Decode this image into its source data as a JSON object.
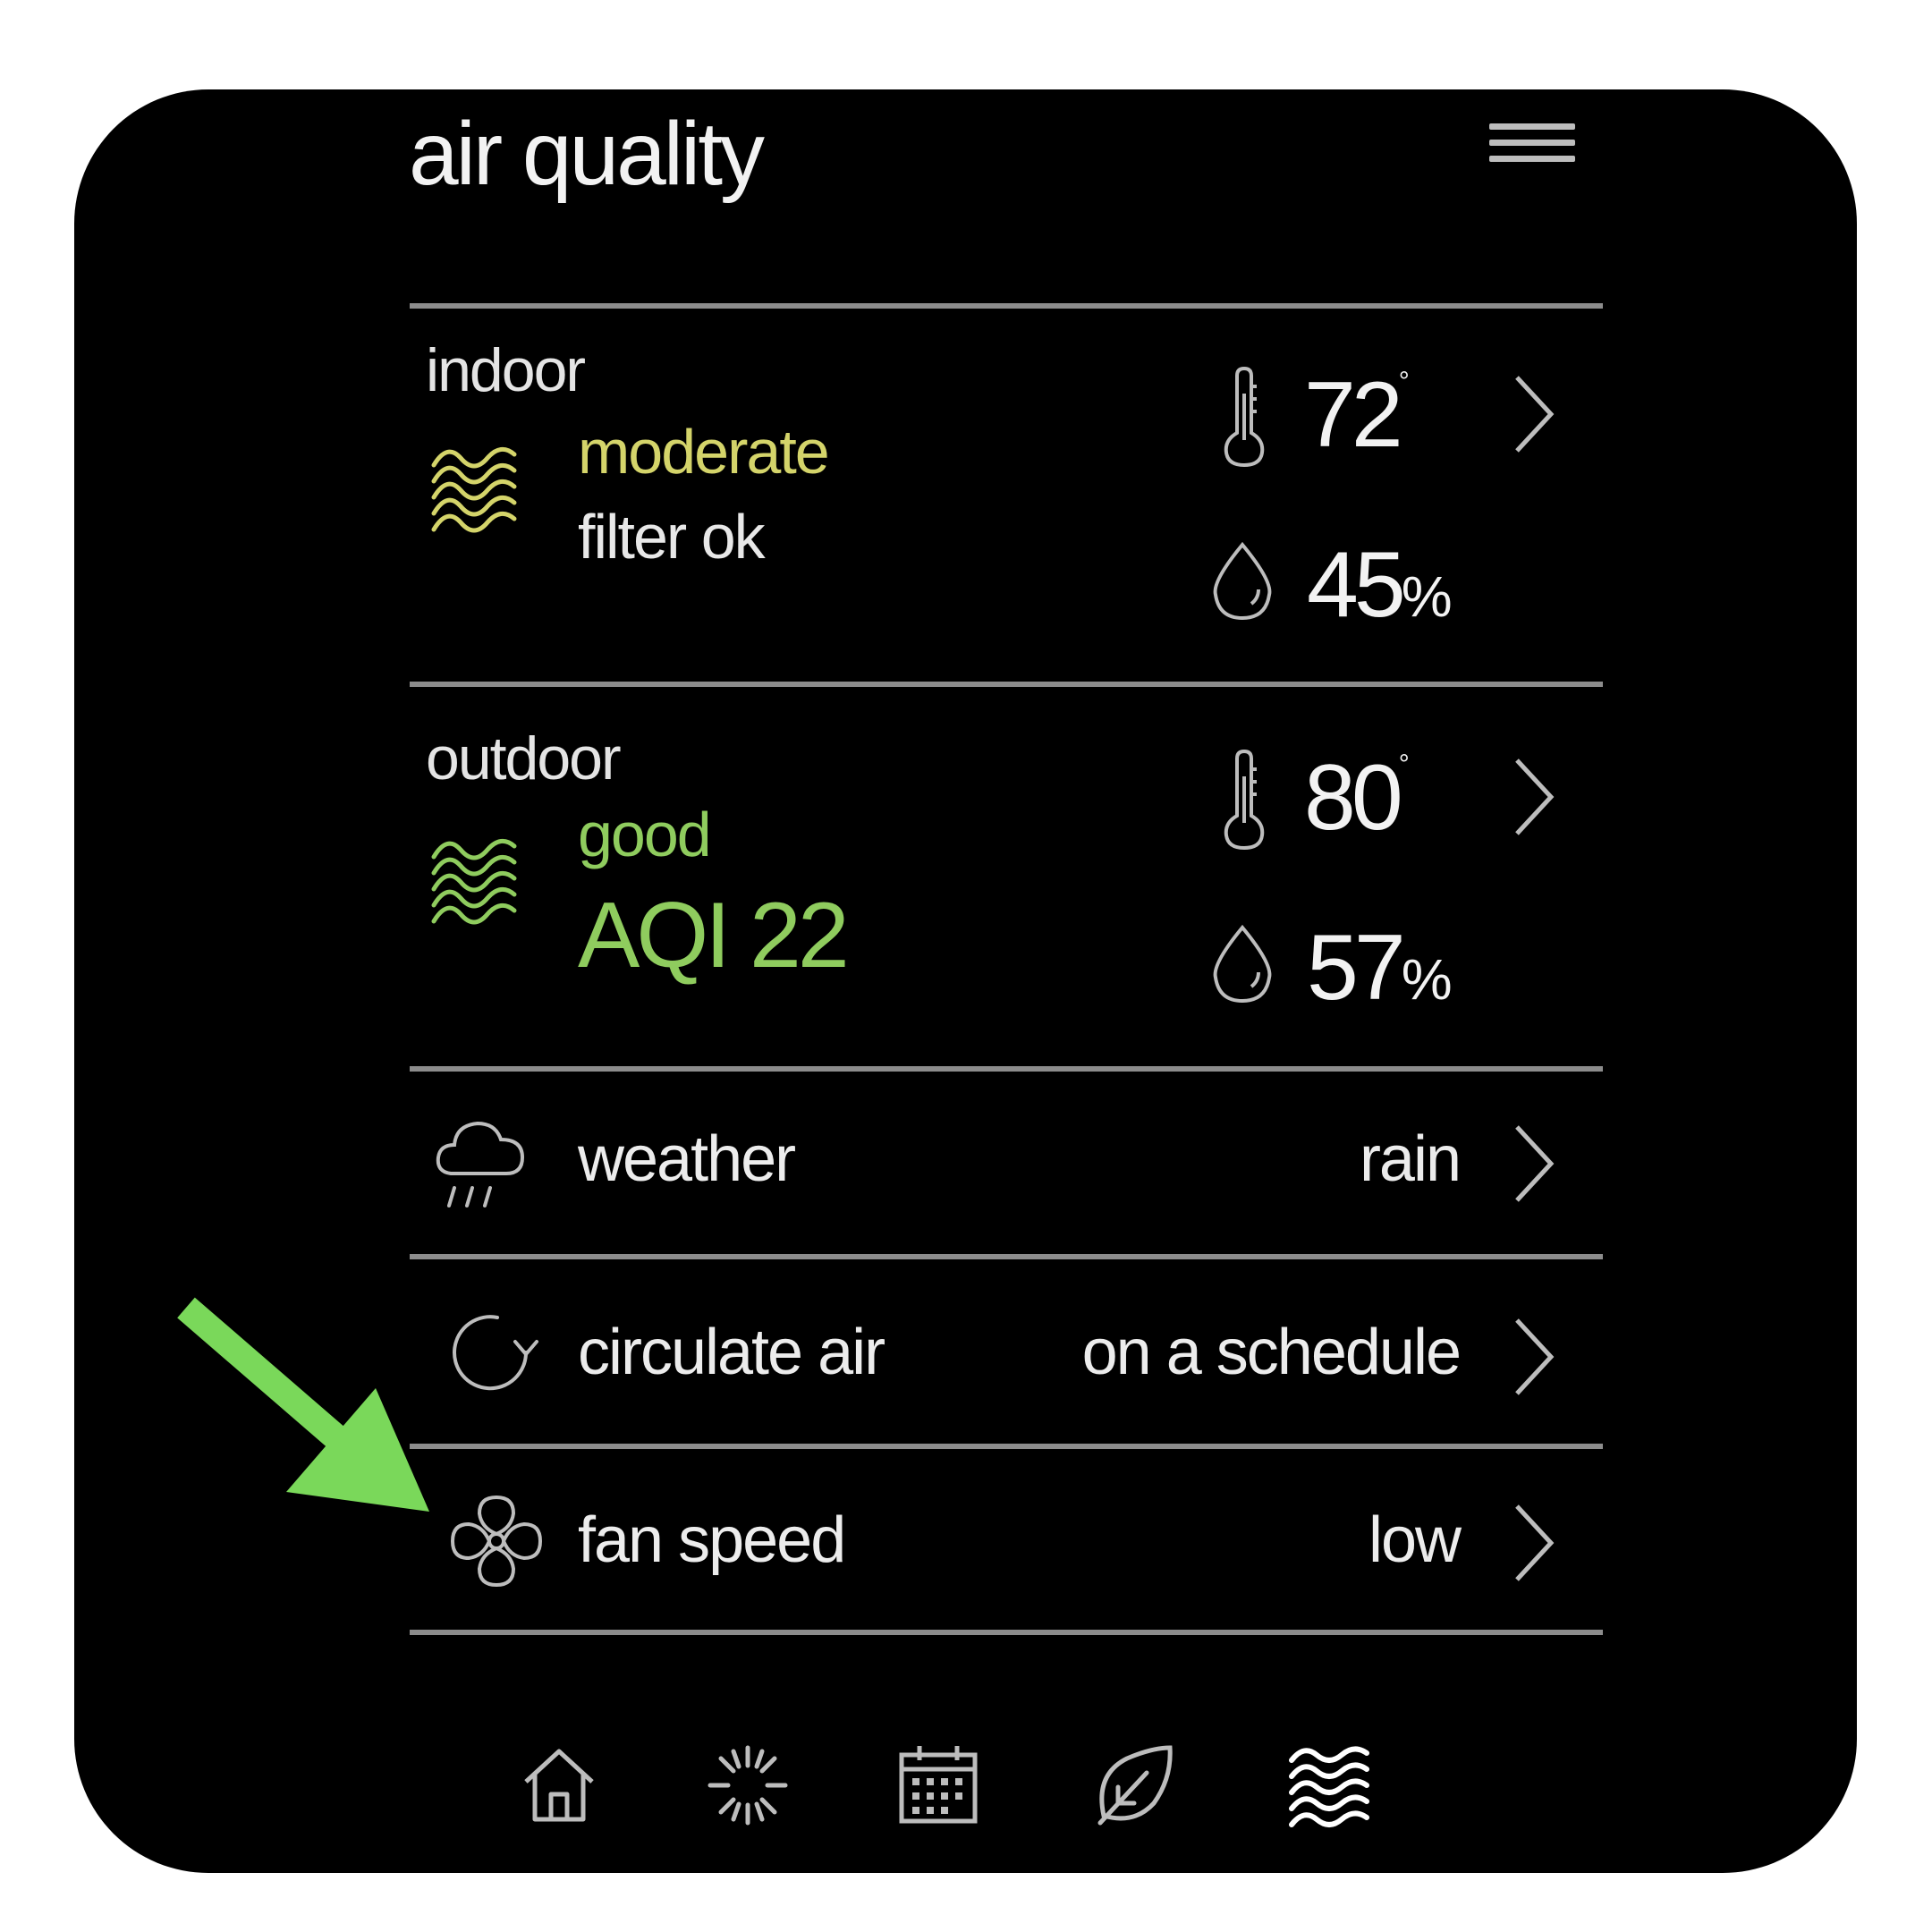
{
  "app": {
    "title": "air quality"
  },
  "indoor": {
    "label": "indoor",
    "quality": "moderate",
    "filter_status": "filter ok",
    "temperature": "72",
    "temperature_unit": "°",
    "humidity": "45",
    "humidity_unit": "%"
  },
  "outdoor": {
    "label": "outdoor",
    "quality": "good",
    "aqi": "AQI 22",
    "temperature": "80",
    "temperature_unit": "°",
    "humidity": "57",
    "humidity_unit": "%"
  },
  "settings": [
    {
      "label": "weather",
      "value": "rain",
      "icon": "rain-cloud-icon"
    },
    {
      "label": "circulate air",
      "value": "on a schedule",
      "icon": "circulate-icon"
    },
    {
      "label": "fan speed",
      "value": "low",
      "icon": "fan-icon"
    }
  ],
  "bottom_nav": [
    {
      "icon": "home-icon"
    },
    {
      "icon": "sun-icon"
    },
    {
      "icon": "calendar-icon"
    },
    {
      "icon": "leaf-icon"
    },
    {
      "icon": "air-waves-icon"
    }
  ],
  "colors": {
    "background": "#000000",
    "text": "#ececec",
    "moderate": "#d4d46a",
    "good": "#8fcc5e",
    "divider": "#8c8c8c",
    "annotation_arrow": "#7ad85a"
  },
  "annotation": {
    "type": "arrow",
    "points_to": "fan-speed-row"
  }
}
